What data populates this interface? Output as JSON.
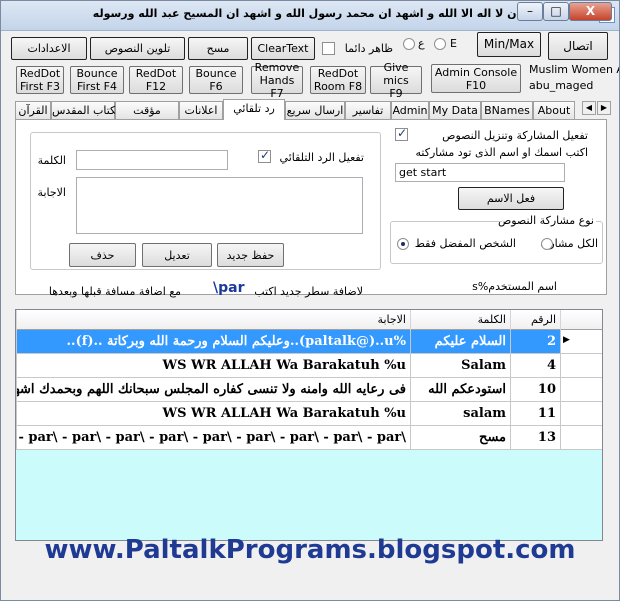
{
  "title": "البيان    -  اشهد ان لا اله الا الله و اشهد ان محمد رسول الله  و  اشهد ان المسيح عبد الله ورسوله",
  "app_icon": "لله",
  "window_buttons": {
    "minimize": "–",
    "maximize": "□",
    "close": "X"
  },
  "toolbar_row1": {
    "settings": "الاعدادات",
    "color_text": "تلوين النصوص",
    "clear": "مسح",
    "clear_text": "ClearText",
    "always_on_top": "ظاهر دائما",
    "radio_a": "ع",
    "radio_e": "E",
    "minmax": "Min/Max",
    "connect": "اتصال"
  },
  "toolbar_row2": {
    "reddot_first": "RedDot\nFirst F3",
    "bounce_first": "Bounce\nFirst F4",
    "reddot_f12": "RedDot\nF12",
    "bounce_f6": "Bounce\nF6",
    "remove_hands": "Remove\nHands F7",
    "reddot_room": "RedDot\nRoom F8",
    "give_mics": "Give mics\nF9",
    "admin_console": "Admin Console\nF10",
    "room_name": "Muslim Women Ar",
    "user_name": "abu_maged"
  },
  "tabs": [
    "القرآن",
    "الكتاب المقدس",
    "مؤقت",
    "اعلانات",
    "رد تلقائي",
    "ارسال سريع",
    "تفاسير",
    "Admin",
    "My Data",
    "BNames",
    "About"
  ],
  "active_tab": "رد تلقائي",
  "auto_reply": {
    "enable_label": "تفعيل الرد التلقائي",
    "word_label": "الكلمة",
    "answer_label": "الاجابة",
    "word_value": "",
    "answer_value": "",
    "save_new": "حفظ جديد",
    "edit": "تعديل",
    "delete": "حذف"
  },
  "share": {
    "enable_label": "تفعيل المشاركة وتنزيل النصوص",
    "prompt": "اكتب اسمك او اسم الذى تود مشاركته",
    "name_value": "get start",
    "activate_name": "فعل الاسم",
    "type_group": "نوع مشاركة النصوص",
    "opt_all": "الكل مشارك",
    "opt_preferred": "الشخص المفضل فقط",
    "selected": "الشخص المفضل فقط"
  },
  "hints": {
    "add_line_prefix": "لاضافة سطر جديد اكتب",
    "par_token": "\\par",
    "add_line_suffix": "مع اضافة مسافة قبلها وبعدها",
    "username_token": "اسم المستخدم%s"
  },
  "grid": {
    "columns": [
      "الرقم",
      "الكلمة",
      "الاجابة"
    ],
    "rows": [
      {
        "num": "2",
        "word": "السلام عليكم",
        "answer": "%paltalk@)..u)..وعليكم السلام ورحمة الله وبركاتة ..(f)..",
        "selected": true
      },
      {
        "num": "4",
        "word": "Salam",
        "answer": "WS WR ALLAH Wa Barakatuh %u",
        "selected": false
      },
      {
        "num": "10",
        "word": "استودعكم الله",
        "answer": "فى رعايه الله وامنه ولا تنسى كفاره المجلس سبحانك اللهم وبحمدك اشهد ان لا اله",
        "selected": false
      },
      {
        "num": "11",
        "word": "salam",
        "answer": "WS WR ALLAH Wa Barakatuh %u",
        "selected": false
      },
      {
        "num": "13",
        "word": "مسح",
        "answer": "\\p\\ - par\\ - par\\ - par\\ - par\\ - par\\ - par\\ - par\\ - par\\ - par\\ - par\\",
        "selected": false
      }
    ]
  },
  "footer": "www.PaltalkPrograms.blogspot.com"
}
